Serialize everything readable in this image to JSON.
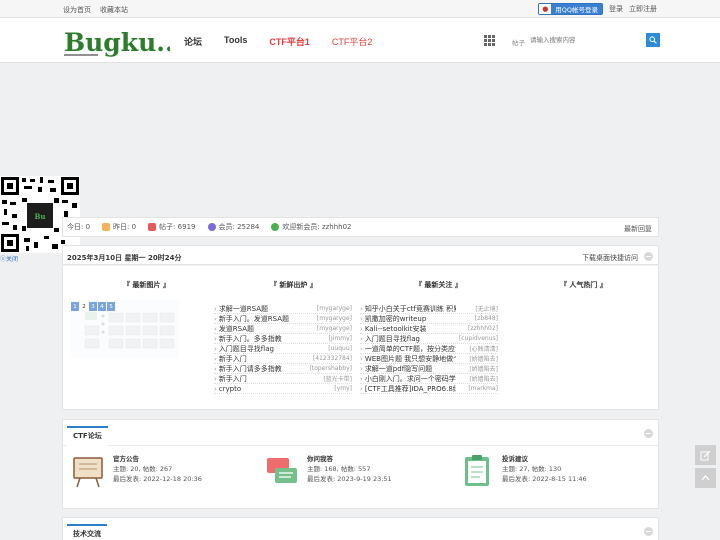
{
  "topbar": {
    "set_home": "设为首页",
    "bookmark": "收藏本站",
    "qq_login": "用QQ帐号登录",
    "login": "登录",
    "register": "立即注册"
  },
  "header": {
    "logo_text": "Bugku...",
    "nav": [
      "论坛",
      "Tools",
      "CTF平台1",
      "CTF平台2"
    ],
    "search_type": "帖子",
    "search_placeholder": "请输入搜索内容"
  },
  "qr": {
    "close": "关闭"
  },
  "stats": {
    "today": "今日: 0",
    "yesterday": "昨日: 0",
    "posts": "帖子: 6919",
    "members": "会员: 25284",
    "welcome": "欢迎新会员: zzhhh02",
    "latest": "最新回复"
  },
  "date_bar": {
    "date": "2025年3月10日 星期一 20时24分",
    "download": "下载桌面快捷访问"
  },
  "columns": {
    "images": "『 最新图片 』",
    "hot": "『 新鲜出炉 』",
    "focus": "『 最新关注 』",
    "popular": "『 人气热门 』"
  },
  "slide_nums": [
    "1",
    "2",
    "3",
    "4",
    "5"
  ],
  "new_posts": [
    {
      "t": "求解一道RSA题",
      "a": "[mygaryge]"
    },
    {
      "t": "新手入门。发道RSA题",
      "a": "[mygaryge]"
    },
    {
      "t": "发道RSA题",
      "a": "[mygaryge]"
    },
    {
      "t": "新手入门。多多指教",
      "a": "[Jimmy]"
    },
    {
      "t": "入门题目寻找flag",
      "a": "[uuquu]"
    },
    {
      "t": "新手入门",
      "a": "[412332784]"
    },
    {
      "t": "新手入门请多多指教",
      "a": "[topershabby]"
    },
    {
      "t": "新手入门",
      "a": "[蓝光卡带]"
    },
    {
      "t": "crypto",
      "a": "[ymy]"
    }
  ],
  "focus_posts": [
    {
      "t": "知乎小白关于ctf竞赛训练 积累的 ...",
      "a": "[无止境]"
    },
    {
      "t": "凯撒加密的writeup",
      "a": "[zb848]"
    },
    {
      "t": "Kali--setoolkit安装",
      "a": "[zzhhh02]"
    },
    {
      "t": "入门题目寻找flag",
      "a": "[cupidvenus]"
    },
    {
      "t": "一道简单的CTF题，按分类应该为 ...",
      "a": "[心贱清清]"
    },
    {
      "t": "WEB图片题 我只想安静地做个美男",
      "a": "[娇嫱陷去]"
    },
    {
      "t": "求解一道pdf隐写问题",
      "a": "[娇嫱陷去]"
    },
    {
      "t": "小白刚入门。求问一个密码学问题",
      "a": "[娇嫱陷去]"
    },
    {
      "t": "[CTF工具推荐]IDA_PRO6.8绿色版_ ...",
      "a": "[markma]"
    }
  ],
  "ctf_section": {
    "title": "CTF论坛",
    "forums": [
      {
        "name": "官方公告",
        "stats": "主题: 20, 帖数: 267",
        "last": "最后发表: 2022-12-18 20:36"
      },
      {
        "name": "你问我答",
        "stats": "主题: 168, 帖数: 557",
        "last": "最后发表: 2023-9-19 23:51"
      },
      {
        "name": "投诉建议",
        "stats": "主题: 27, 帖数: 130",
        "last": "最后发表: 2022-8-15 11:46"
      }
    ]
  },
  "tech_section": {
    "title": "技术交流"
  }
}
